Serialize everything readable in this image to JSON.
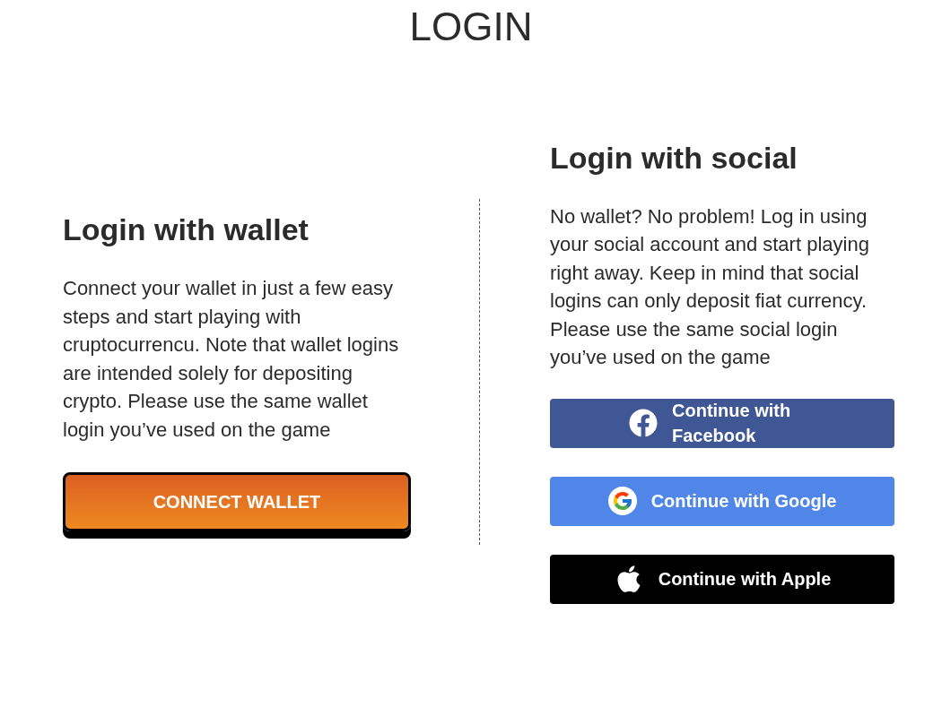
{
  "title": "LOGIN",
  "wallet": {
    "heading": "Login with wallet",
    "description": "Connect your wallet in just a few easy steps and start playing with cruptocurrencu. Note that wallet logins are intended solely for depositing crypto. Please use the same wallet login you’ve used on the game",
    "button": "CONNECT WALLET"
  },
  "social": {
    "heading": "Login with social",
    "description": "No wallet? No problem! Log in using your social account and start playing right away. Keep in mind that social logins can only deposit fiat currency. Please use the same social login you’ve used on the game",
    "buttons": [
      {
        "kind": "facebook",
        "label": "Continue with Facebook"
      },
      {
        "kind": "google",
        "label": "Continue with Google"
      },
      {
        "kind": "apple",
        "label": "Continue with Apple"
      }
    ]
  }
}
